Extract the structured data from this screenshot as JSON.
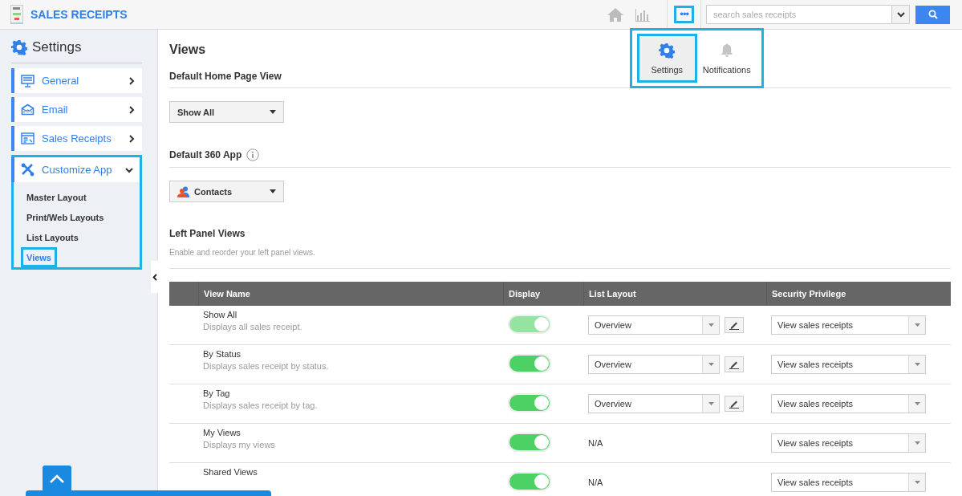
{
  "app": {
    "title": "SALES RECEIPTS"
  },
  "top_bar": {
    "more_button": {
      "label": "•••",
      "highlighted": true
    },
    "search": {
      "placeholder": "search sales receipts"
    }
  },
  "more_menu": {
    "highlighted": true,
    "items": [
      {
        "label": "Settings",
        "kind": "gear",
        "selected": true,
        "highlighted": true
      },
      {
        "label": "Notifications",
        "kind": "bell",
        "selected": false,
        "highlighted": false
      }
    ]
  },
  "sidebar": {
    "title": "Settings",
    "items": [
      {
        "label": "General",
        "kind": "monitor",
        "expanded": false,
        "highlighted": false
      },
      {
        "label": "Email",
        "kind": "envelope",
        "expanded": false,
        "highlighted": false
      },
      {
        "label": "Sales Receipts",
        "kind": "receipt",
        "expanded": false,
        "highlighted": false
      },
      {
        "label": "Customize App",
        "kind": "tools",
        "expanded": true,
        "highlighted": true,
        "children": [
          {
            "label": "Master Layout",
            "selected": false,
            "highlighted": false
          },
          {
            "label": "Print/Web Layouts",
            "selected": false,
            "highlighted": false
          },
          {
            "label": "List Layouts",
            "selected": false,
            "highlighted": false
          },
          {
            "label": "Views",
            "selected": true,
            "highlighted": true
          }
        ]
      }
    ]
  },
  "main": {
    "title": "Views",
    "home_view": {
      "heading": "Default Home Page View",
      "value": "Show All"
    },
    "app_360": {
      "heading": "Default 360 App",
      "value": "Contacts"
    },
    "left_panel": {
      "heading": "Left Panel Views",
      "description": "Enable and reorder your left panel views."
    },
    "table": {
      "columns": [
        "View Name",
        "Display",
        "List Layout",
        "Security Privilege"
      ],
      "rows": [
        {
          "name": "Show All",
          "description": "Displays all sales receipt.",
          "display": {
            "on": true,
            "disabled": true
          },
          "list_layout": {
            "kind": "select",
            "value": "Overview"
          },
          "privilege": "View sales receipts"
        },
        {
          "name": "By Status",
          "description": "Displays sales receipt by status.",
          "display": {
            "on": true,
            "disabled": false
          },
          "list_layout": {
            "kind": "select",
            "value": "Overview"
          },
          "privilege": "View sales receipts"
        },
        {
          "name": "By Tag",
          "description": "Displays sales receipt by tag.",
          "display": {
            "on": true,
            "disabled": false
          },
          "list_layout": {
            "kind": "select",
            "value": "Overview"
          },
          "privilege": "View sales receipts"
        },
        {
          "name": "My Views",
          "description": "Displays my views",
          "display": {
            "on": true,
            "disabled": false
          },
          "list_layout": {
            "kind": "text",
            "value": "N/A"
          },
          "privilege": "View sales receipts"
        },
        {
          "name": "Shared Views",
          "display": {
            "on": true,
            "disabled": false
          },
          "list_layout": {
            "kind": "text",
            "value": "N/A"
          },
          "privilege": "View sales receipts"
        }
      ]
    }
  }
}
